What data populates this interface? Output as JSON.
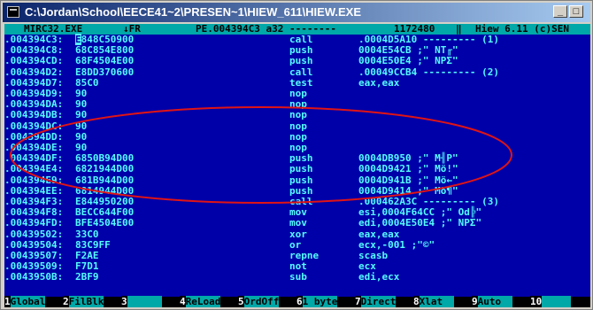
{
  "window": {
    "title": "C:\\Jordan\\School\\EECE41~2\\PRESEN~1\\HIEW_611\\HIEW.EXE",
    "minimize_label": "_",
    "maximize_label": "□"
  },
  "header": {
    "file": "MIRC32.EXE",
    "mode": "↓FR",
    "position": "PE.004394C3 a32 --------",
    "size": "1172480",
    "separator": "‖",
    "version": "Hiew 6.11 (c)SEN"
  },
  "rows": [
    {
      "addr": ".004394C3:",
      "bytes": "E848C50900",
      "mnem": "call",
      "ops": ".0004D5A10 --------- (1)"
    },
    {
      "addr": ".004394C8:",
      "bytes": "68C854E800",
      "mnem": "push",
      "ops": "0004E54CB ;\" NT╓\""
    },
    {
      "addr": ".004394CD:",
      "bytes": "68F4504E00",
      "mnem": "push",
      "ops": "0004E50E4 ;\" NPΣ\""
    },
    {
      "addr": ".004394D2:",
      "bytes": "E8DD370600",
      "mnem": "call",
      "ops": ".00049CCB4 --------- (2)"
    },
    {
      "addr": ".004394D7:",
      "bytes": "85C0",
      "mnem": "test",
      "ops": "eax,eax"
    },
    {
      "addr": ".004394D9:",
      "bytes": "90",
      "mnem": "nop",
      "ops": ""
    },
    {
      "addr": ".004394DA:",
      "bytes": "90",
      "mnem": "nop",
      "ops": ""
    },
    {
      "addr": ".004394DB:",
      "bytes": "90",
      "mnem": "nop",
      "ops": ""
    },
    {
      "addr": ".004394DC:",
      "bytes": "90",
      "mnem": "nop",
      "ops": ""
    },
    {
      "addr": ".004394DD:",
      "bytes": "90",
      "mnem": "nop",
      "ops": ""
    },
    {
      "addr": ".004394DE:",
      "bytes": "90",
      "mnem": "nop",
      "ops": ""
    },
    {
      "addr": ".004394DF:",
      "bytes": "6850B94D00",
      "mnem": "push",
      "ops": "0004DB950 ;\" M╢P\""
    },
    {
      "addr": ".004394E4:",
      "bytes": "6821944D00",
      "mnem": "push",
      "ops": "0004D9421 ;\" Mö!\""
    },
    {
      "addr": ".004394E9:",
      "bytes": "681B944D00",
      "mnem": "push",
      "ops": "0004D941B ;\" Mö←\""
    },
    {
      "addr": ".004394EE:",
      "bytes": "6814944D00",
      "mnem": "push",
      "ops": "0004D9414 ;\" Mö¶\""
    },
    {
      "addr": ".004394F3:",
      "bytes": "E844950200",
      "mnem": "call",
      "ops": ".000462A3C --------- (3)"
    },
    {
      "addr": ".004394F8:",
      "bytes": "BECC644F00",
      "mnem": "mov",
      "ops": "esi,0004F64CC ;\" Od╠\""
    },
    {
      "addr": ".004394FD:",
      "bytes": "BFE4504E00",
      "mnem": "mov",
      "ops": "edi,0004E50E4 ;\" NPΣ\""
    },
    {
      "addr": ".00439502:",
      "bytes": "33C0",
      "mnem": "xor",
      "ops": "eax,eax"
    },
    {
      "addr": ".00439504:",
      "bytes": "83C9FF",
      "mnem": "or",
      "ops": "ecx,-001 ;\"©\""
    },
    {
      "addr": ".00439507:",
      "bytes": "F2AE",
      "mnem": "repne",
      "ops": "scasb"
    },
    {
      "addr": ".00439509:",
      "bytes": "F7D1",
      "mnem": "not",
      "ops": "ecx"
    },
    {
      "addr": ".0043950B:",
      "bytes": "2BF9",
      "mnem": "sub",
      "ops": "edi,ecx"
    }
  ],
  "fkeys": [
    {
      "num": "1",
      "label": "Global"
    },
    {
      "num": "2",
      "label": "FilBlk"
    },
    {
      "num": "3",
      "label": "      "
    },
    {
      "num": "4",
      "label": "ReLoad"
    },
    {
      "num": "5",
      "label": "OrdOff"
    },
    {
      "num": "6",
      "label": "1 byte"
    },
    {
      "num": "7",
      "label": "Direct"
    },
    {
      "num": "8",
      "label": "Xlat  "
    },
    {
      "num": "9",
      "label": "Auto  "
    },
    {
      "num": "10",
      "label": "     "
    }
  ],
  "annotation_color": "#e01414",
  "colors": {
    "console_bg": "#0000a8",
    "text": "#54fcfc",
    "header_bg": "#00a8a8"
  }
}
